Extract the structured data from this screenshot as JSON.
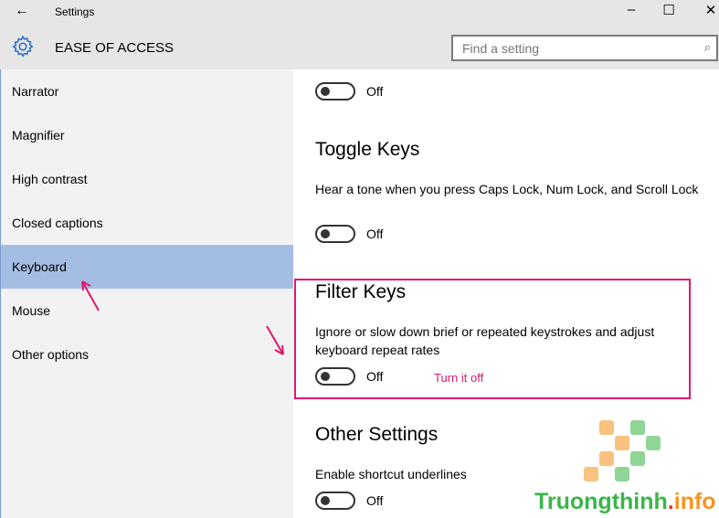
{
  "window": {
    "title": "Settings",
    "minimize": "–",
    "maximize": "☐",
    "close": "✕",
    "back": "←"
  },
  "header": {
    "section": "EASE OF ACCESS",
    "search_placeholder": "Find a setting",
    "icon": "gear-icon",
    "search_icon": "search-icon"
  },
  "sidebar": {
    "items": [
      {
        "label": "Narrator"
      },
      {
        "label": "Magnifier"
      },
      {
        "label": "High contrast"
      },
      {
        "label": "Closed captions"
      },
      {
        "label": "Keyboard",
        "selected": true
      },
      {
        "label": "Mouse"
      },
      {
        "label": "Other options"
      }
    ]
  },
  "content": {
    "top_toggle": {
      "state": "Off"
    },
    "toggle_keys": {
      "title": "Toggle Keys",
      "desc": "Hear a tone when you press Caps Lock, Num Lock, and Scroll Lock",
      "state": "Off"
    },
    "filter_keys": {
      "title": "Filter Keys",
      "desc": "Ignore or slow down brief or repeated keystrokes and adjust keyboard repeat rates",
      "state": "Off"
    },
    "other": {
      "title": "Other Settings",
      "desc": "Enable shortcut underlines",
      "state": "Off"
    }
  },
  "annotation": {
    "text": "Turn it off",
    "color": "#e0166e"
  },
  "watermark": {
    "name": "Truongthinh",
    "dot": ".",
    "suffix": "info"
  }
}
